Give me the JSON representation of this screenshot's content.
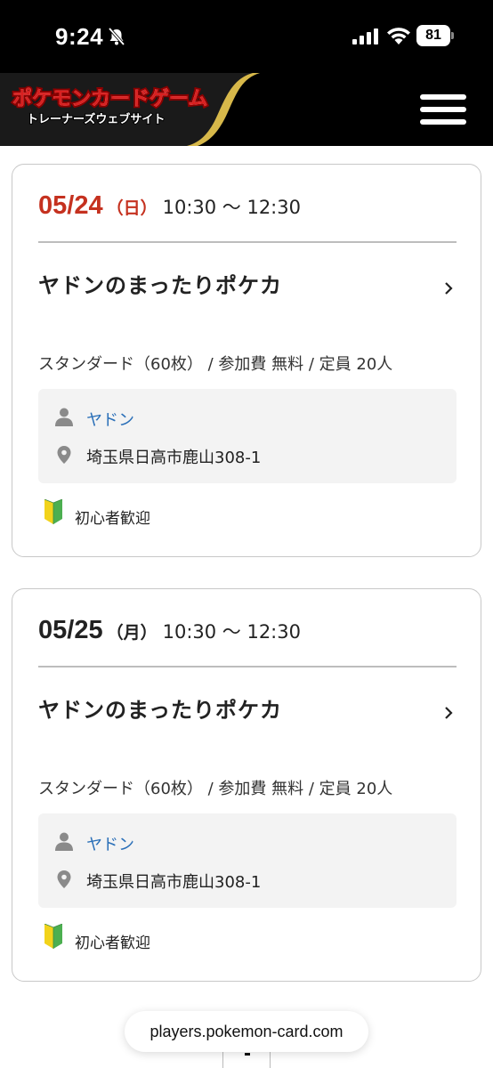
{
  "status_bar": {
    "time": "9:24",
    "battery": "81"
  },
  "header": {
    "logo_line1": "ポケモンカードゲーム",
    "logo_line2": "トレーナーズウェブサイト"
  },
  "events": [
    {
      "date": "05/24",
      "day": "（日）",
      "time": "10:30 〜 12:30",
      "date_color": "#c5311f",
      "title": "ヤドンのまったりポケカ",
      "details": "スタンダード（60枚） / 参加費 無料 / 定員 20人",
      "organizer": "ヤドン",
      "address": "埼玉県日高市鹿山308-1",
      "tag": "初心者歓迎"
    },
    {
      "date": "05/25",
      "day": "（月）",
      "time": "10:30 〜 12:30",
      "date_color": "#222222",
      "title": "ヤドンのまったりポケカ",
      "details": "スタンダード（60枚） / 参加費 無料 / 定員 20人",
      "organizer": "ヤドン",
      "address": "埼玉県日高市鹿山308-1",
      "tag": "初心者歓迎"
    }
  ],
  "browser": {
    "url": "players.pokemon-card.com"
  },
  "colors": {
    "accent_red": "#c5311f",
    "link_blue": "#2a6fb8",
    "beginner_green": "#4caf50",
    "beginner_yellow": "#f2d31b"
  }
}
